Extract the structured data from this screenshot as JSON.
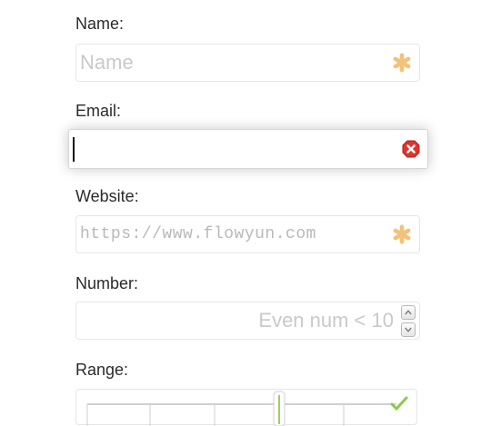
{
  "form": {
    "name": {
      "label": "Name:",
      "placeholder": "Name",
      "value": "",
      "status_icon": "asterisk-required-icon"
    },
    "email": {
      "label": "Email:",
      "placeholder": "",
      "value": "",
      "status_icon": "error-x-icon"
    },
    "website": {
      "label": "Website:",
      "placeholder": "https://www.flowyun.com",
      "value": "",
      "status_icon": "asterisk-required-icon"
    },
    "number": {
      "label": "Number:",
      "placeholder": "Even num < 10",
      "value": "",
      "spinner_icons": [
        "chevron-up-icon",
        "chevron-down-icon"
      ]
    },
    "range": {
      "label": "Range:",
      "status_icon": "check-icon"
    }
  },
  "colors": {
    "required": "#f3c27a",
    "error": "#e1322d",
    "valid": "#8cc84b"
  }
}
